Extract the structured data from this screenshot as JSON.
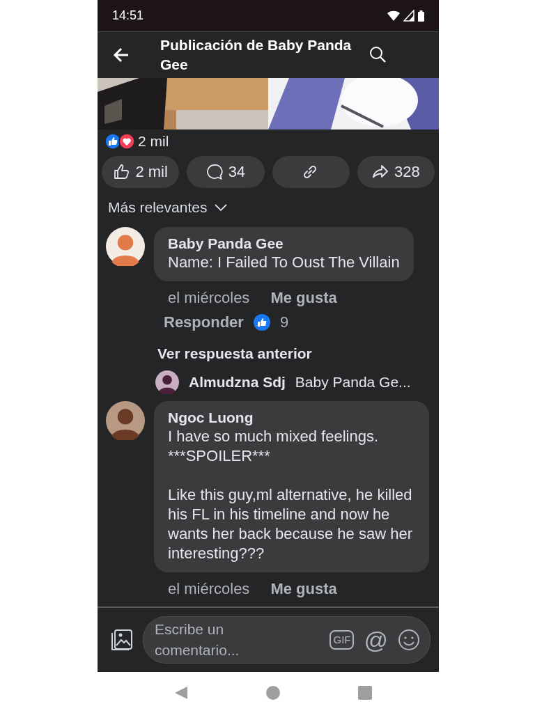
{
  "status_bar": {
    "time": "14:51"
  },
  "header": {
    "title": "Publicación de Baby Panda Gee"
  },
  "post": {
    "reaction_count": "2 mil",
    "actions": [
      {
        "kind": "like",
        "label": "2 mil"
      },
      {
        "kind": "comment",
        "label": "34"
      },
      {
        "kind": "link"
      },
      {
        "kind": "share",
        "label": "328"
      }
    ]
  },
  "sort": {
    "label": "Más relevantes"
  },
  "comments": [
    {
      "author": "Baby Panda Gee",
      "text": "Name: I Failed To Oust The Villain",
      "time": "el miércoles",
      "like_action": "Me gusta",
      "reply_action": "Responder",
      "like_count": "9",
      "more_replies": "Ver respuesta anterior",
      "reply_preview": {
        "author": "Almudzna Sdj",
        "text": "Baby Panda Ge..."
      }
    },
    {
      "author": "Ngoc Luong",
      "text": "I have so much mixed feelings.\n***SPOILER***\n\nLike this guy,ml alternative, he killed his FL in his timeline and now he wants her back because he saw her interesting???",
      "time": "el miércoles",
      "like_action": "Me gusta"
    }
  ],
  "composer": {
    "placeholder": "Escribe un comentario...",
    "gif_label": "GIF",
    "mention_label": "@"
  }
}
